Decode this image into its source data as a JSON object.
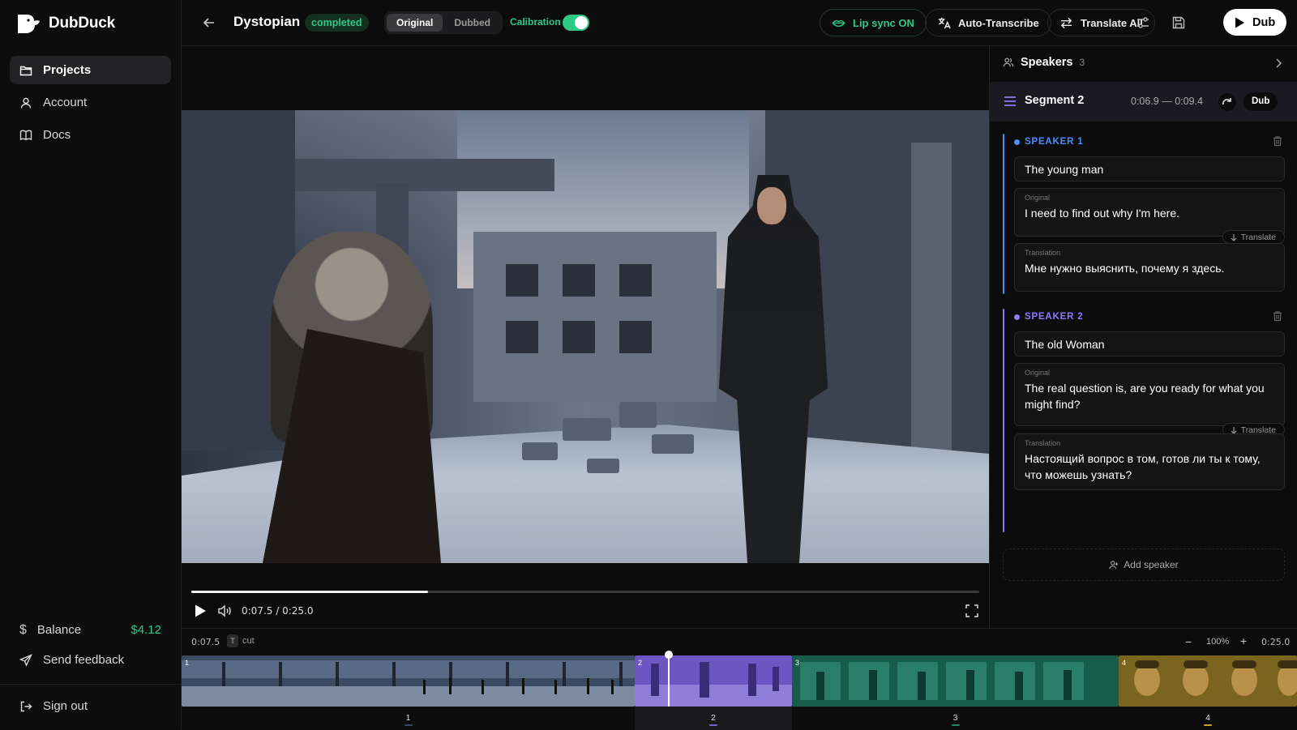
{
  "app": {
    "name": "DubDuck"
  },
  "sidebar": {
    "items": [
      {
        "label": "Projects",
        "icon": "folder-icon",
        "active": true
      },
      {
        "label": "Account",
        "icon": "user-icon",
        "active": false
      },
      {
        "label": "Docs",
        "icon": "book-icon",
        "active": false
      }
    ],
    "balance_label": "Balance",
    "balance_value": "$4.12",
    "feedback_label": "Send feedback",
    "signout_label": "Sign out"
  },
  "header": {
    "title": "Dystopian",
    "status": "completed",
    "view_options": [
      "Original",
      "Dubbed"
    ],
    "selected_view": "Original",
    "calibration_label": "Calibration",
    "calibration_on": true,
    "lipsync_label": "Lip sync ON",
    "autotranscribe_label": "Auto-Transcribe",
    "translate_all_label": "Translate All",
    "dub_label": "Dub"
  },
  "player": {
    "time_display": "0:07.5 / 0:25.0",
    "progress": 0.3
  },
  "panel": {
    "speakers_title": "Speakers",
    "speakers_count": "3",
    "segment_name": "Segment 2",
    "segment_range": "0:06.9 — 0:09.4",
    "dub_label": "Dub",
    "speakers": [
      {
        "label": "SPEAKER 1",
        "color": "#4f8ef7",
        "name": "The young man",
        "original_label": "Original",
        "original_text": "I need to find out why I'm here.",
        "translate_label": "Translate",
        "translation_label": "Translation",
        "translation_text": "Мне нужно выяснить, почему я здесь."
      },
      {
        "label": "SPEAKER 2",
        "color": "#8b7cf6",
        "name": "The old Woman",
        "original_label": "Original",
        "original_text": "The real question is, are you ready for what you might find?",
        "translate_label": "Translate",
        "translation_label": "Translation",
        "translation_text": "Настоящий вопрос в том, готов ли ты к тому, что можешь узнать?"
      }
    ],
    "add_speaker_label": "Add speaker"
  },
  "timeline": {
    "current_time": "0:07.5",
    "shortcut_key": "T",
    "shortcut_label": "cut",
    "zoom": "100%",
    "end_time": "0:25.0",
    "segments": [
      {
        "label": "1",
        "color": "#3a4a66"
      },
      {
        "label": "2",
        "color": "#7b5fd6"
      },
      {
        "label": "3",
        "color": "#1f8a6a"
      },
      {
        "label": "4",
        "color": "#c9a227"
      }
    ]
  }
}
